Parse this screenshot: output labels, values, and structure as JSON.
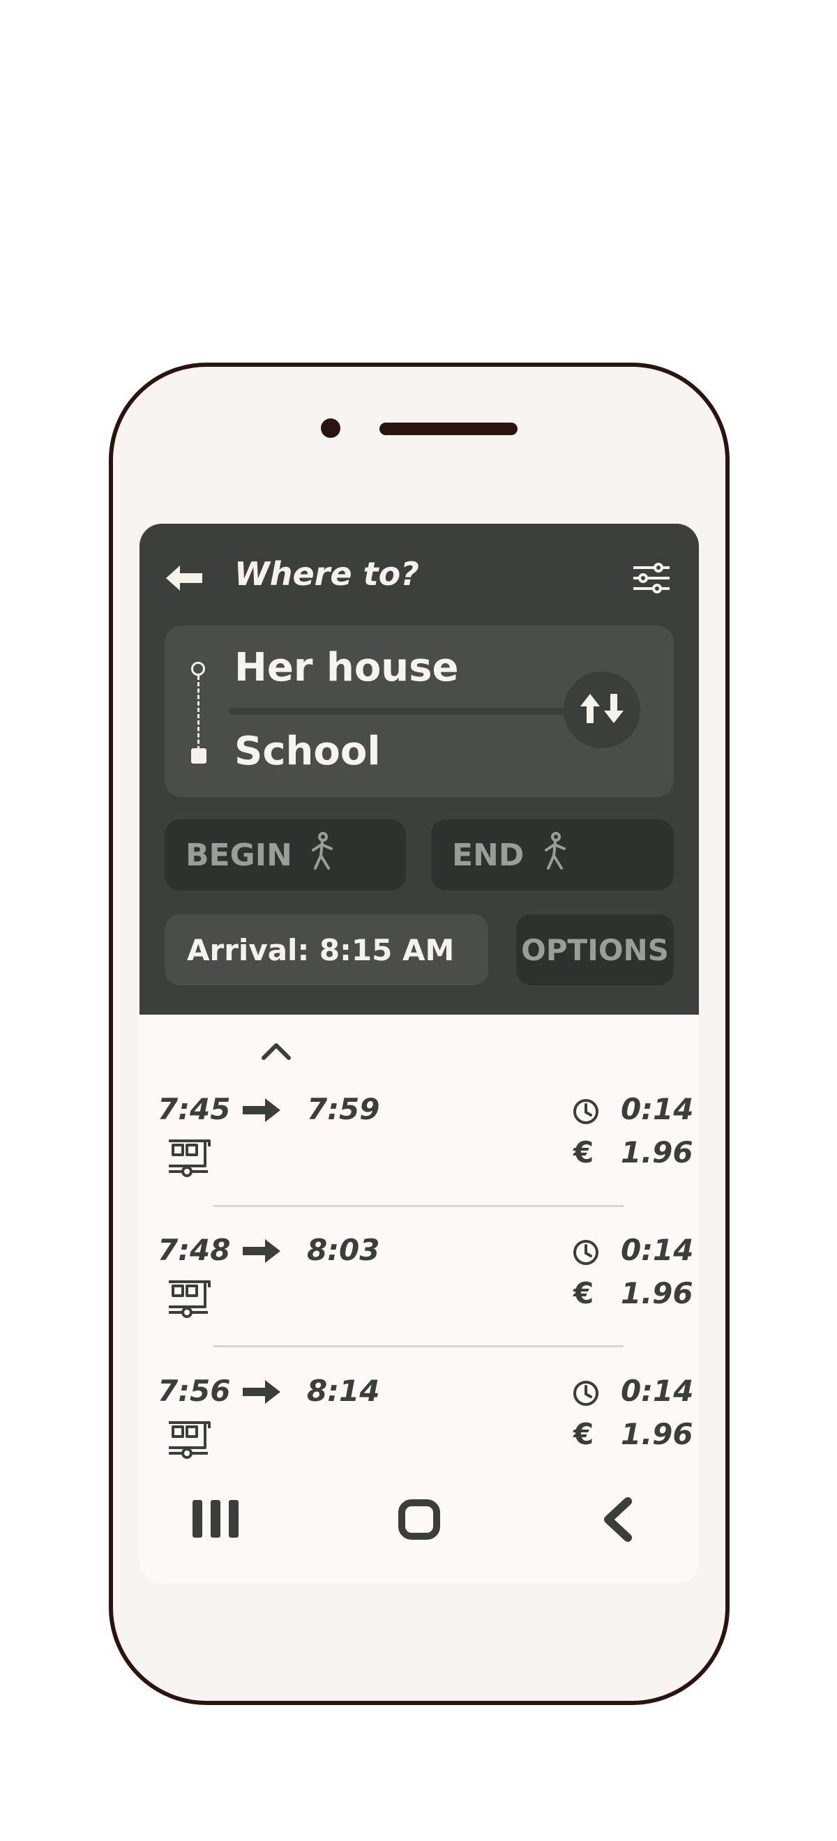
{
  "header": {
    "title": "Where to?",
    "back_icon": "arrow-left-icon",
    "filter_icon": "sliders-icon"
  },
  "route": {
    "origin": "Her house",
    "destination": "School",
    "swap_icon": "swap-vertical-icon"
  },
  "begin": {
    "label": "BEGIN",
    "icon": "walking-person-icon"
  },
  "end": {
    "label": "END",
    "icon": "walking-person-icon"
  },
  "arrival": {
    "label": "Arrival: 8:15 AM"
  },
  "options": {
    "label": "OPTIONS"
  },
  "trips": [
    {
      "depart": "7:45",
      "arrive": "7:59",
      "duration": "0:14",
      "currency": "€",
      "price": "1.96",
      "mode_icon": "tram-icon"
    },
    {
      "depart": "7:48",
      "arrive": "8:03",
      "duration": "0:14",
      "currency": "€",
      "price": "1.96",
      "mode_icon": "tram-icon"
    },
    {
      "depart": "7:56",
      "arrive": "8:14",
      "duration": "0:14",
      "currency": "€",
      "price": "1.96",
      "mode_icon": "tram-icon"
    }
  ],
  "nav": {
    "recents_icon": "recents-icon",
    "home_icon": "home-icon",
    "back_icon": "back-chevron-icon"
  },
  "colors": {
    "panel": "#3c3f3b",
    "card": "#4a4d49",
    "pill": "#2e312d",
    "text_light": "#f5f2ee",
    "text_dark": "#3b3e3a",
    "frame": "#2a1410"
  }
}
